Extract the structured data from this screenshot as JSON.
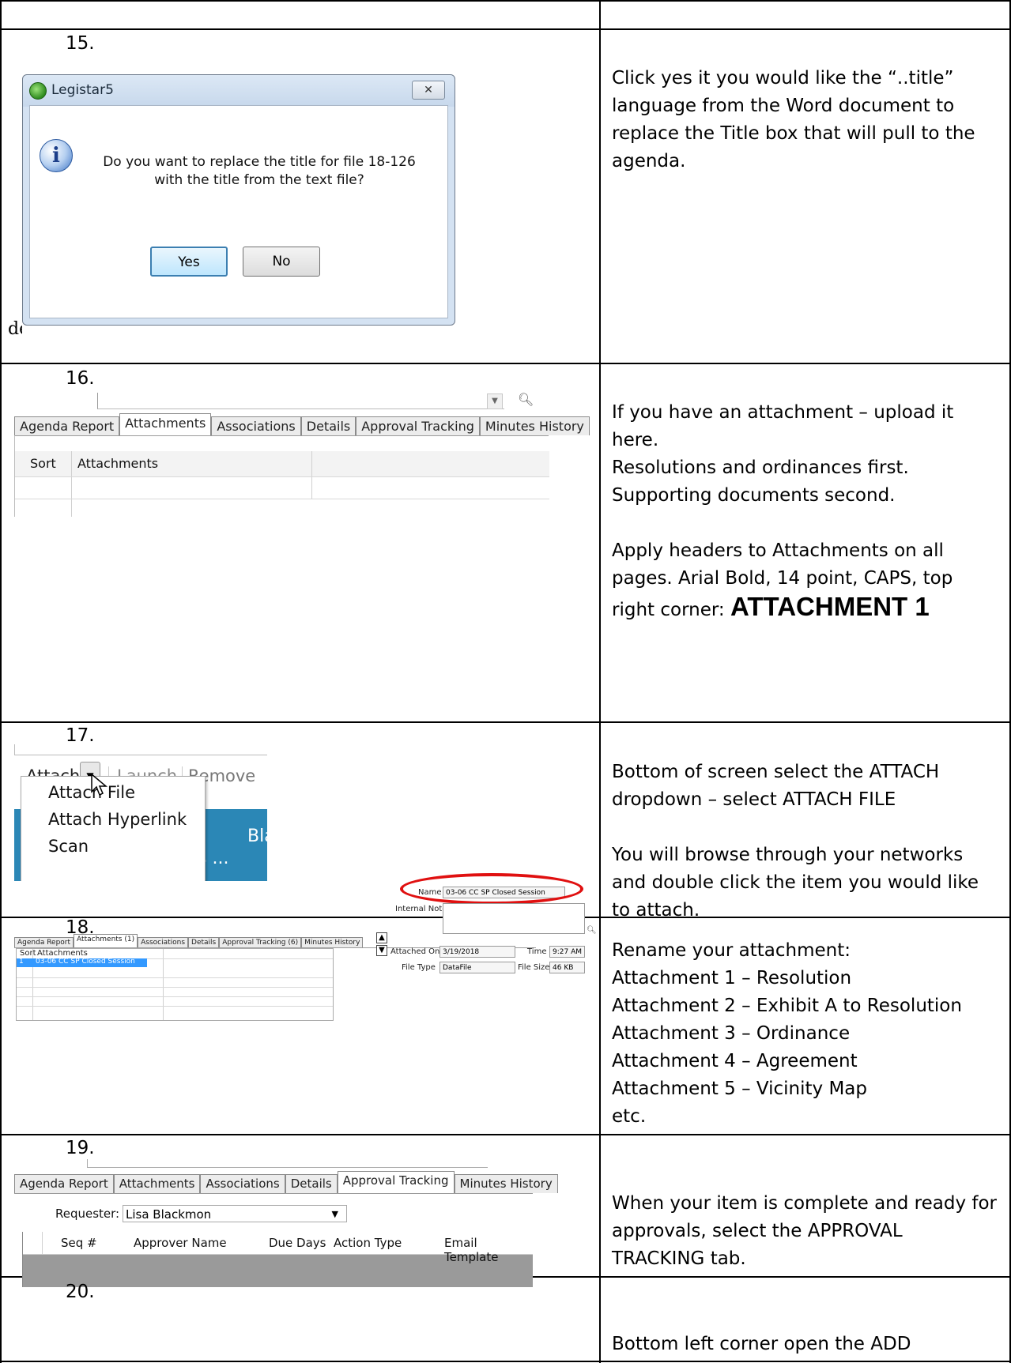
{
  "steps": {
    "s15": {
      "number": "15.",
      "dialog": {
        "title": "Legistar5",
        "close_label": "✕",
        "info_glyph": "i",
        "message_line1": "Do you want to replace the title for file 18-126",
        "message_line2": "with the title from the text file?",
        "yes_label": "Yes",
        "no_label": "No",
        "edge_fragment": "de"
      },
      "description": "Click yes it you would like the  “..title” language from the Word document to replace the Title box that will pull to the agenda."
    },
    "s16": {
      "number": "16.",
      "tabs": [
        "Agenda Report",
        "Attachments",
        "Associations",
        "Details",
        "Approval Tracking",
        "Minutes History"
      ],
      "active_tab": "Attachments",
      "columns": [
        "Sort",
        "Attachments"
      ],
      "description_lines": [
        "If you have an attachment – upload it here.",
        "Resolutions and ordinances first.",
        "Supporting documents second.",
        "",
        "Apply headers to Attachments on all pages. Arial Bold, 14 point, CAPS, top right corner: "
      ],
      "header_example": "ATTACHMENT 1"
    },
    "s17": {
      "number": "17.",
      "toolbar": {
        "attach": "Attach",
        "launch": "Launch",
        "remove": "Remove"
      },
      "menu_items": [
        "Attach File",
        "Attach Hyperlink",
        "Scan"
      ],
      "background_fragments": [
        "Bla",
        "s ..."
      ],
      "description_para1": "Bottom of screen select the ATTACH dropdown – select ATTACH FILE",
      "description_para2": "You will browse through your networks and double click the item you would like to attach."
    },
    "s18": {
      "number": "18.",
      "tabs": [
        "Agenda Report",
        "Attachments (1)",
        "Associations",
        "Details",
        "Approval Tracking (6)",
        "Minutes History"
      ],
      "active_tab": "Attachments (1)",
      "columns": [
        "Sort",
        "Attachments"
      ],
      "row": {
        "sort": "1",
        "name": "03-06 CC SP Closed Session"
      },
      "fields": {
        "name_label": "Name",
        "name_value": "03-06 CC SP Closed Session",
        "notes_label": "Internal Notes",
        "attached_on_label": "Attached On",
        "attached_on_value": "3/19/2018",
        "time_label": "Time",
        "time_value": "9:27 AM",
        "file_type_label": "File Type",
        "file_type_value": "DataFile",
        "file_size_label": "File Size",
        "file_size_value": "46 KB"
      },
      "description_lines": [
        "Rename your attachment:",
        "Attachment 1 – Resolution",
        "Attachment 2 – Exhibit A to Resolution",
        "Attachment 3 – Ordinance",
        "Attachment 4 – Agreement",
        "Attachment 5 – Vicinity Map",
        "etc."
      ]
    },
    "s19": {
      "number": "19.",
      "tabs": [
        "Agenda Report",
        "Attachments",
        "Associations",
        "Details",
        "Approval Tracking",
        "Minutes History"
      ],
      "active_tab": "Approval Tracking",
      "requester_label": "Requester:",
      "requester_value": "Lisa Blackmon",
      "columns": [
        "Seq #",
        "Approver Name",
        "Due Days",
        "Action Type",
        "Email Template"
      ],
      "description": "When your item is complete and ready for approvals, select the APPROVAL TRACKING tab."
    },
    "s20": {
      "number": "20.",
      "description": "Bottom left corner open the ADD"
    }
  },
  "colors": {
    "selection": "#3399ff",
    "highlight_ellipse": "#e01010",
    "app_blue": "#2b87b6"
  }
}
